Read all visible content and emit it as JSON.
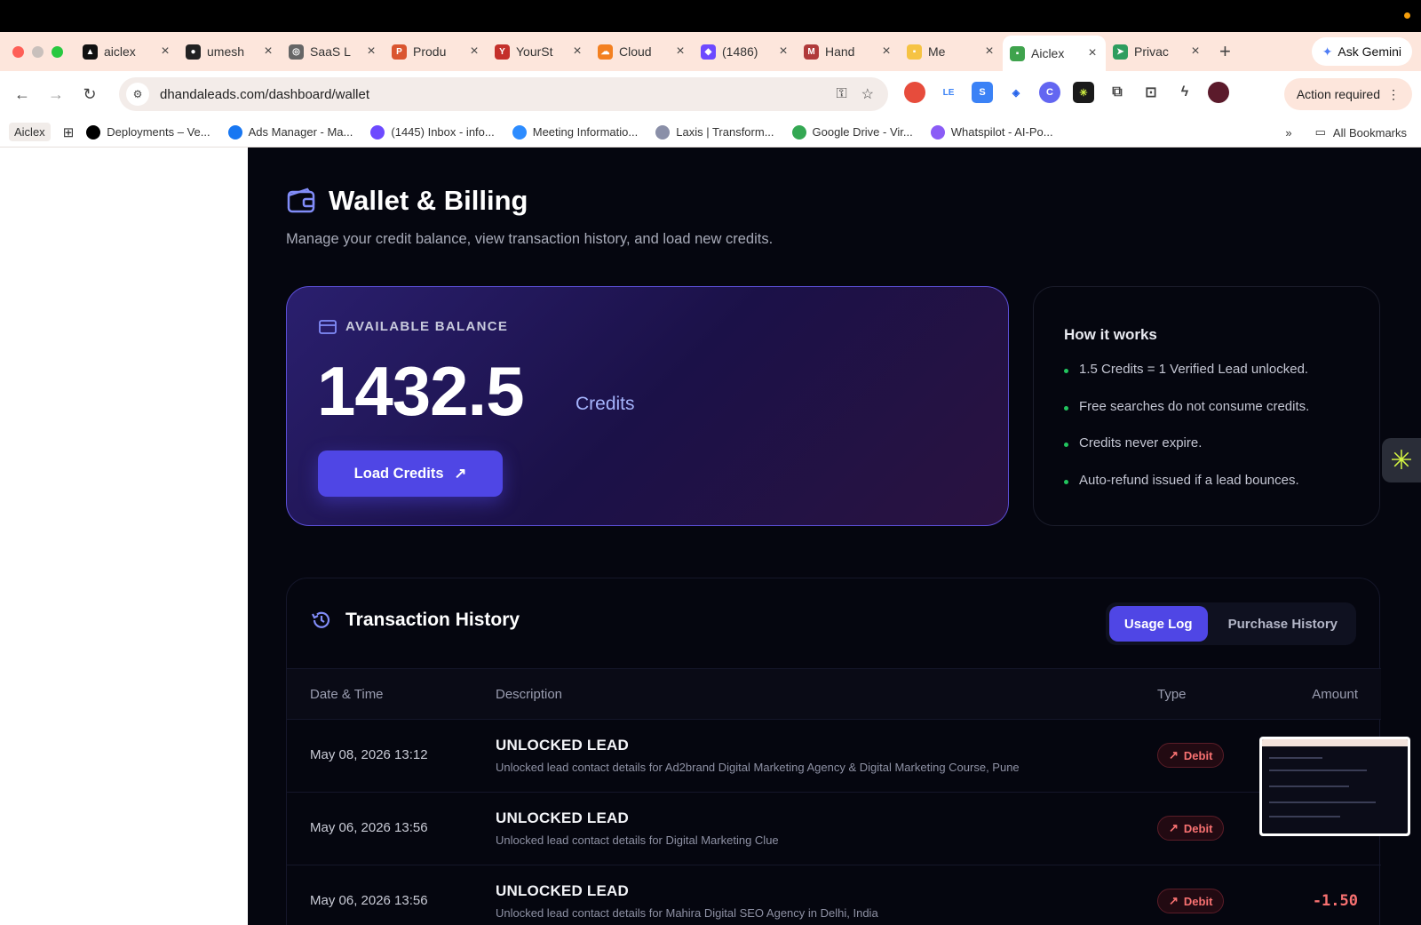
{
  "browser": {
    "tabs": [
      {
        "title": "aiclex",
        "color": "#111111",
        "glyph": "▲"
      },
      {
        "title": "umesh",
        "color": "#222222",
        "glyph": "●"
      },
      {
        "title": "SaaS L",
        "color": "#666666",
        "glyph": "◎"
      },
      {
        "title": "Produ",
        "color": "#da552f",
        "glyph": "P"
      },
      {
        "title": "YourSt",
        "color": "#c4302b",
        "glyph": "Y"
      },
      {
        "title": "Cloud",
        "color": "#f38020",
        "glyph": "☁"
      },
      {
        "title": "(1486)",
        "color": "#6d4aff",
        "glyph": "◆"
      },
      {
        "title": "Hand",
        "color": "#b03a3a",
        "glyph": "M"
      },
      {
        "title": "Me",
        "color": "#f6c343",
        "glyph": "▪"
      },
      {
        "title": "Aiclex",
        "color": "#3fa34d",
        "glyph": "▪"
      },
      {
        "title": "Privac",
        "color": "#2e9d5e",
        "glyph": "➤"
      }
    ],
    "ask_gemini": "Ask Gemini",
    "url": "dhandaleads.com/dashboard/wallet",
    "action_required": "Action required",
    "bookmarks": {
      "folder_chip": "Aiclex",
      "items": [
        {
          "label": "Deployments – Ve...",
          "color": "#000000"
        },
        {
          "label": "Ads Manager - Ma...",
          "color": "#1877f2"
        },
        {
          "label": "(1445) Inbox - info...",
          "color": "#6d4aff"
        },
        {
          "label": "Meeting Informatio...",
          "color": "#2d8cff"
        },
        {
          "label": "Laxis | Transform...",
          "color": "#8a8fa8"
        },
        {
          "label": "Google Drive - Vir...",
          "color": "#34a853"
        },
        {
          "label": "Whatspilot - AI-Po...",
          "color": "#8b5cf6"
        }
      ],
      "all_bookmarks": "All Bookmarks"
    }
  },
  "page": {
    "title": "Wallet & Billing",
    "subtitle": "Manage your credit balance, view transaction history, and load new credits."
  },
  "balance": {
    "label": "AVAILABLE BALANCE",
    "value": "1432.5",
    "unit": "Credits",
    "load_button": "Load Credits"
  },
  "how_it_works": {
    "title": "How it works",
    "items": [
      "1.5 Credits = 1 Verified Lead unlocked.",
      "Free searches do not consume credits.",
      "Credits never expire.",
      "Auto-refund issued if a lead bounces."
    ]
  },
  "transactions": {
    "title": "Transaction History",
    "tabs": {
      "usage": "Usage Log",
      "purchase": "Purchase History"
    },
    "columns": {
      "date": "Date & Time",
      "description": "Description",
      "type": "Type",
      "amount": "Amount"
    },
    "rows": [
      {
        "date": "May 08, 2026 13:12",
        "title": "UNLOCKED LEAD",
        "detail": "Unlocked lead contact details for Ad2brand Digital Marketing Agency & Digital Marketing Course, Pune",
        "type": "Debit",
        "amount": ""
      },
      {
        "date": "May 06, 2026 13:56",
        "title": "UNLOCKED LEAD",
        "detail": "Unlocked lead contact details for Digital Marketing Clue",
        "type": "Debit",
        "amount": ""
      },
      {
        "date": "May 06, 2026 13:56",
        "title": "UNLOCKED LEAD",
        "detail": "Unlocked lead contact details for Mahira Digital SEO Agency in Delhi, India",
        "type": "Debit",
        "amount": "-1.50"
      }
    ]
  },
  "colors": {
    "accent": "#4f46e5",
    "debit": "#f87171",
    "background": "#05060f"
  }
}
